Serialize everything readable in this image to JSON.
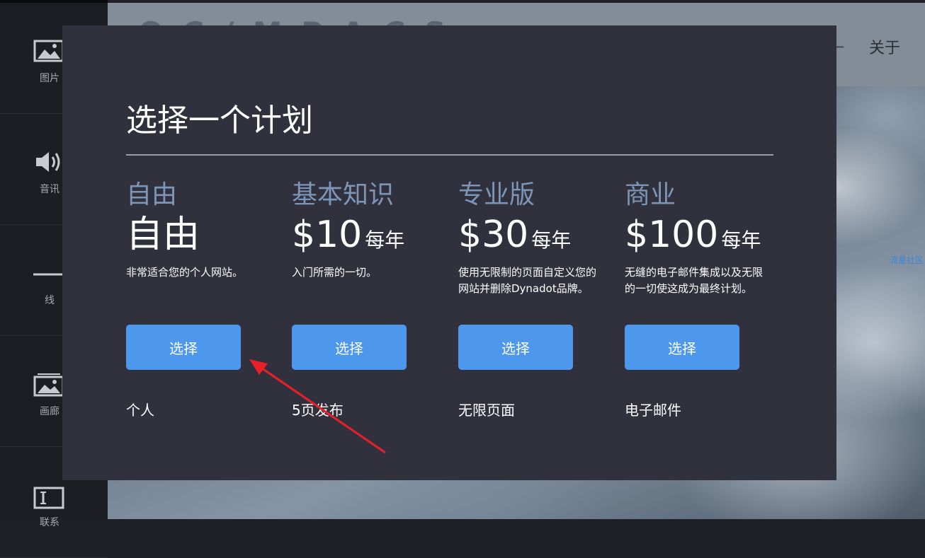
{
  "sidebar": {
    "items": [
      {
        "label": "图片",
        "icon": "image-icon"
      },
      {
        "label": "音讯",
        "icon": "speaker-icon"
      },
      {
        "label": "线",
        "icon": "line-icon"
      },
      {
        "label": "画廊",
        "icon": "gallery-icon"
      },
      {
        "label": "联系",
        "icon": "contact-form-icon"
      }
    ]
  },
  "background": {
    "nav_about": "关于",
    "side_link": "流星社区"
  },
  "modal": {
    "title": "选择一个计划",
    "plans": [
      {
        "name": "自由",
        "price": "自由",
        "period": "",
        "desc_lines": [
          "非常适合您的个人网站。"
        ],
        "button": "选择",
        "feature": "个人"
      },
      {
        "name": "基本知识",
        "price": "$10",
        "period": "每年",
        "desc_lines": [
          "入门所需的一切。"
        ],
        "button": "选择",
        "feature": "5页发布"
      },
      {
        "name": "专业版",
        "price": "$30",
        "period": "每年",
        "desc_lines": [
          "使用无限制的页面自定义您的",
          "网站并删除Dynadot品牌。"
        ],
        "button": "选择",
        "feature": "无限页面"
      },
      {
        "name": "商业",
        "price": "$100",
        "period": "每年",
        "desc_lines": [
          "无缝的电子邮件集成以及无限",
          "的一切使这成为最终计划。"
        ],
        "button": "选择",
        "feature": "电子邮件"
      }
    ]
  },
  "colors": {
    "modal_bg": "#30313d",
    "plan_name": "#7d96b8",
    "button": "#4d97ed",
    "arrow": "#e8202a"
  }
}
